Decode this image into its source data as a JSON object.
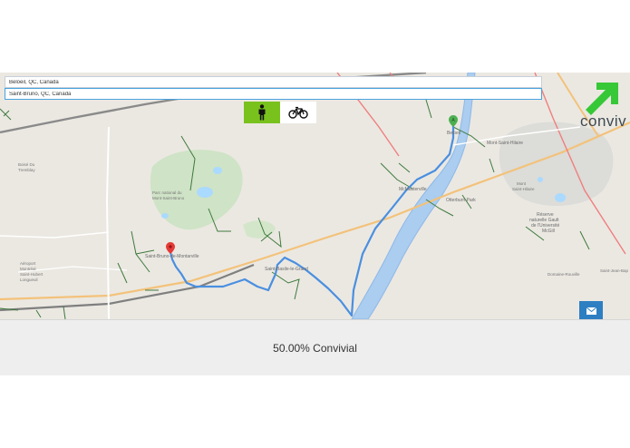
{
  "search": {
    "origin": "Beloeil, QC, Canada",
    "destination": "Saint-Bruno, QC, Canada"
  },
  "modes": [
    {
      "name": "walk",
      "icon": "pedestrian-icon",
      "selected": true,
      "color": "#79c21d"
    },
    {
      "name": "bike",
      "icon": "bicycle-icon",
      "selected": false
    }
  ],
  "logo": {
    "text": "conviv",
    "icon": "arrow-up-right-icon",
    "color": "#37c837"
  },
  "map": {
    "labels": {
      "boisee_tremblay": [
        "Boisé Du",
        "Tremblay"
      ],
      "parc_national": [
        "Parc national du",
        "Mont-Saint-Bruno"
      ],
      "saint_bruno": "Saint-Bruno-de-Montarville",
      "saint_basile": "Saint-Basile-le-Grand",
      "aeroport": [
        "Aéroport",
        "Montréal",
        "Saint-Hubert",
        "Longueuil"
      ],
      "beloeil": "Beloeil",
      "mcmasterville": "McMasterville",
      "otterburn": "Otterburn Park",
      "mont_saint_hilaire": "Mont-Saint-Hilaire",
      "mont_saint": [
        "Mont",
        "Saint-Hilaire"
      ],
      "reserve": [
        "Réserve",
        "naturelle Gault",
        "de l'Université",
        "McGill"
      ],
      "domaine": "Domaine-Rouville",
      "saint_jean": "Saint-Jean-Bap"
    },
    "markers": [
      {
        "name": "origin-marker",
        "label": "A",
        "color": "#4caf50"
      },
      {
        "name": "destination-marker",
        "label": "",
        "color": "#e53935"
      }
    ],
    "route_color": "#4a8fe0"
  },
  "share": {
    "icon": "envelope-icon",
    "color": "#2e7fc2"
  },
  "result": {
    "score_text": "50.00% Convivial"
  }
}
